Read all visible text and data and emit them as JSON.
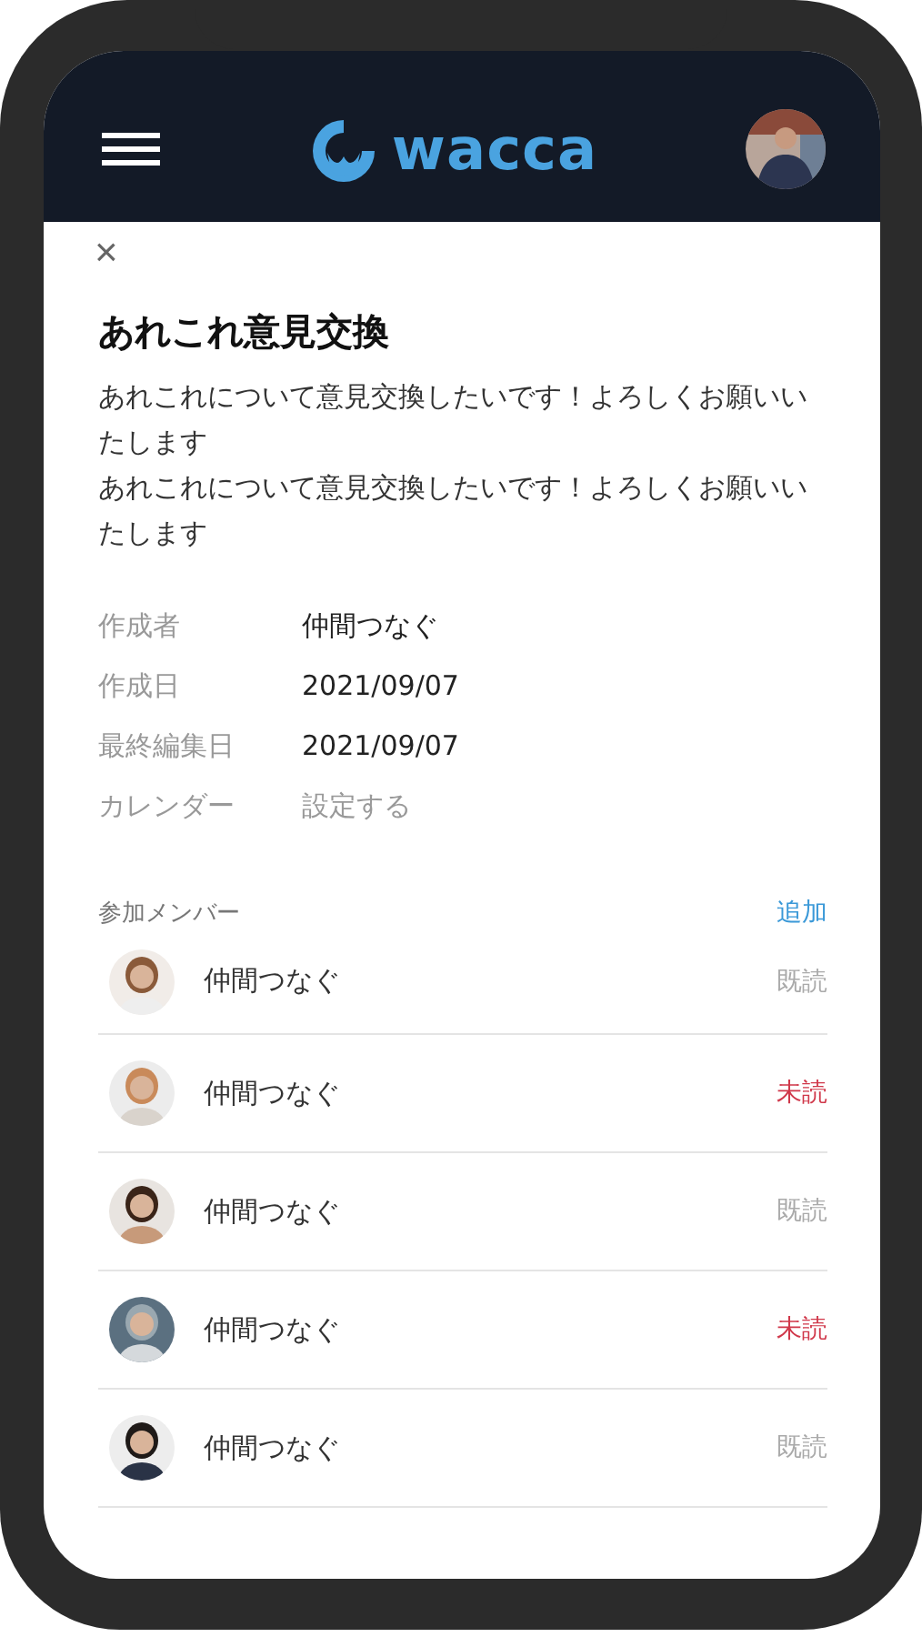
{
  "header": {
    "logo_text": "wacca"
  },
  "detail": {
    "close": "×",
    "title": "あれこれ意見交換",
    "description": [
      "あれこれについて意見交換したいです！よろしくお願いいたします",
      "あれこれについて意見交換したいです！よろしくお願いいたします"
    ],
    "meta": [
      {
        "label": "作成者",
        "value": "仲間つなぐ",
        "muted": false
      },
      {
        "label": "作成日",
        "value": "2021/09/07",
        "muted": false
      },
      {
        "label": "最終編集日",
        "value": "2021/09/07",
        "muted": false
      },
      {
        "label": "カレンダー",
        "value": "設定する",
        "muted": true
      }
    ]
  },
  "members": {
    "title": "参加メンバー",
    "add": "追加",
    "items": [
      {
        "name": "仲間つなぐ",
        "status": "既読",
        "read": true
      },
      {
        "name": "仲間つなぐ",
        "status": "未読",
        "read": false
      },
      {
        "name": "仲間つなぐ",
        "status": "既読",
        "read": true
      },
      {
        "name": "仲間つなぐ",
        "status": "未読",
        "read": false
      },
      {
        "name": "仲間つなぐ",
        "status": "既読",
        "read": true
      }
    ]
  }
}
